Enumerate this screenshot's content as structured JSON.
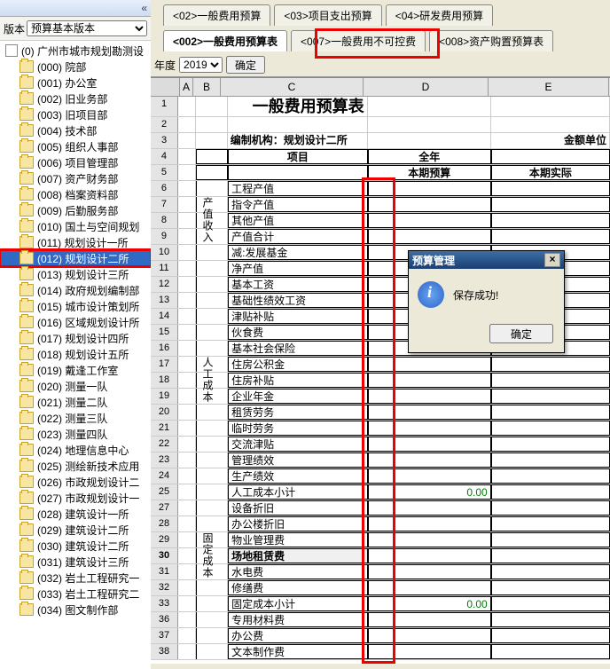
{
  "version_label": "版本",
  "version_combo": "预算基本版本",
  "tree": {
    "root": "(0) 广州市城市规划勘测设",
    "children": [
      "(000) 院部",
      "(001) 办公室",
      "(002) 旧业务部",
      "(003) 旧项目部",
      "(004) 技术部",
      "(005) 组织人事部",
      "(006) 项目管理部",
      "(007) 资产财务部",
      "(008) 档案资料部",
      "(009) 后勤服务部",
      "(010) 国土与空间规划",
      "(011) 规划设计一所",
      "(012) 规划设计二所",
      "(013) 规划设计三所",
      "(014) 政府规划编制部",
      "(015) 城市设计策划所",
      "(016) 区域规划设计所",
      "(017) 规划设计四所",
      "(018) 规划设计五所",
      "(019) 戴逢工作室",
      "(020) 测量一队",
      "(021) 测量二队",
      "(022) 测量三队",
      "(023) 测量四队",
      "(024) 地理信息中心",
      "(025) 测绘新技术应用",
      "(026) 市政规划设计二",
      "(027) 市政规划设计一",
      "(028) 建筑设计一所",
      "(029) 建筑设计二所",
      "(030) 建筑设计二所",
      "(031) 建筑设计三所",
      "(032) 岩土工程研究一",
      "(033) 岩土工程研究二",
      "(034) 图文制作部"
    ],
    "selected_index": 12
  },
  "tabs_top": [
    {
      "label": "<02>一般费用预算",
      "active": false
    },
    {
      "label": "<03>项目支出预算",
      "active": false
    },
    {
      "label": "<04>研发费用预算",
      "active": false
    }
  ],
  "tabs_bottom": [
    {
      "label": "<002>一般费用预算表",
      "active": true
    },
    {
      "label": "<007>一般费用不可控费",
      "active": false
    },
    {
      "label": "<008>资产购置预算表",
      "active": false
    }
  ],
  "year_label": "年度",
  "year_value": "2019",
  "confirm_btn": "确定",
  "columns": {
    "A": "A",
    "B": "B",
    "C": "C",
    "D": "D",
    "E": "E"
  },
  "title": "一般费用预算表",
  "org_label": "编制机构：规划设计二所",
  "unit_label": "金额单位",
  "header": {
    "item": "项目",
    "year": "全年",
    "budget": "本期预算",
    "actual": "本期实际"
  },
  "group1": {
    "label": "产值收入",
    "rows": [
      "工程产值",
      "指令产值",
      "其他产值",
      "产值合计",
      "减:发展基金",
      "净产值"
    ]
  },
  "group2": {
    "label": "人工成本",
    "rows": [
      "基本工资",
      "基础性绩效工资",
      "津贴补贴",
      "伙食费",
      "基本社会保险",
      "住房公积金",
      "住房补贴",
      "企业年金",
      "租赁劳务",
      "临时劳务",
      "交流津贴",
      "管理绩效",
      "生产绩效",
      "人工成本小计"
    ],
    "subtotal": "0.00"
  },
  "group3": {
    "label": "固定成本",
    "rows": [
      "设备折旧",
      "办公楼折旧",
      "物业管理费",
      "场地租赁费",
      "水电费",
      "修缮费",
      "固定成本小计"
    ],
    "subtotal": "0.00"
  },
  "group4": {
    "rows": [
      "专用材料费",
      "办公费",
      "文本制作费"
    ]
  },
  "dialog": {
    "title": "预算管理",
    "message": "保存成功!",
    "ok": "确定"
  }
}
